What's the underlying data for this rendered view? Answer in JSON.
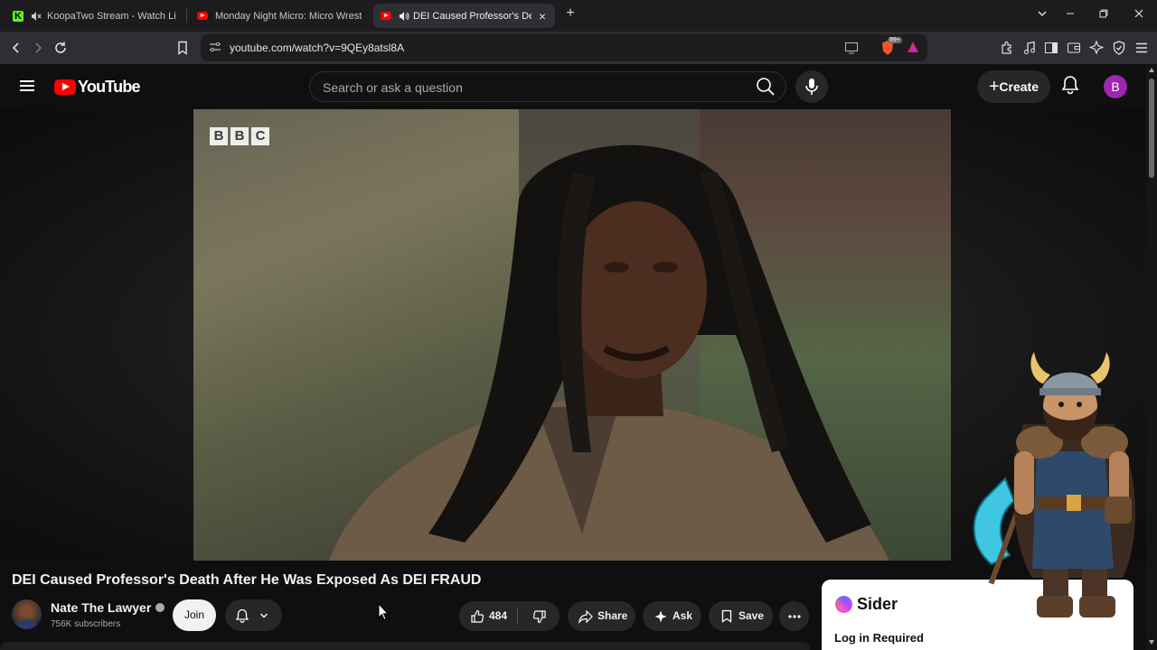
{
  "browser": {
    "tabs": [
      {
        "label": "KoopaTwo Stream - Watch Live o",
        "icon": "kick-icon",
        "muted": true
      },
      {
        "label": "Monday Night Micro: Micro Wrestling",
        "icon": "youtube-icon"
      },
      {
        "label": "DEI Caused Professor's Death",
        "icon": "youtube-icon",
        "active": true
      }
    ],
    "url": "youtube.com/watch?v=9QEy8atsl8A",
    "brave_badge": "99+"
  },
  "youtube": {
    "logo_text": "YouTube",
    "search_placeholder": "Search or ask a question",
    "create_label": "Create",
    "account_initial": "B"
  },
  "video": {
    "watermark_letters": [
      "B",
      "B",
      "C"
    ],
    "title": "DEI Caused Professor's Death After He Was Exposed As DEI FRAUD",
    "channel_name": "Nate The Lawyer",
    "subscribers": "756K subscribers",
    "join_label": "Join",
    "likes": "484",
    "share_label": "Share",
    "ask_label": "Ask",
    "save_label": "Save"
  },
  "sider": {
    "brand": "Sider",
    "login_text": "Log in Required"
  },
  "colors": {
    "youtube_red": "#ff0000",
    "page_bg": "#0f0f0f",
    "pill_bg": "#272727",
    "avatar_purple": "#9c27b0"
  }
}
